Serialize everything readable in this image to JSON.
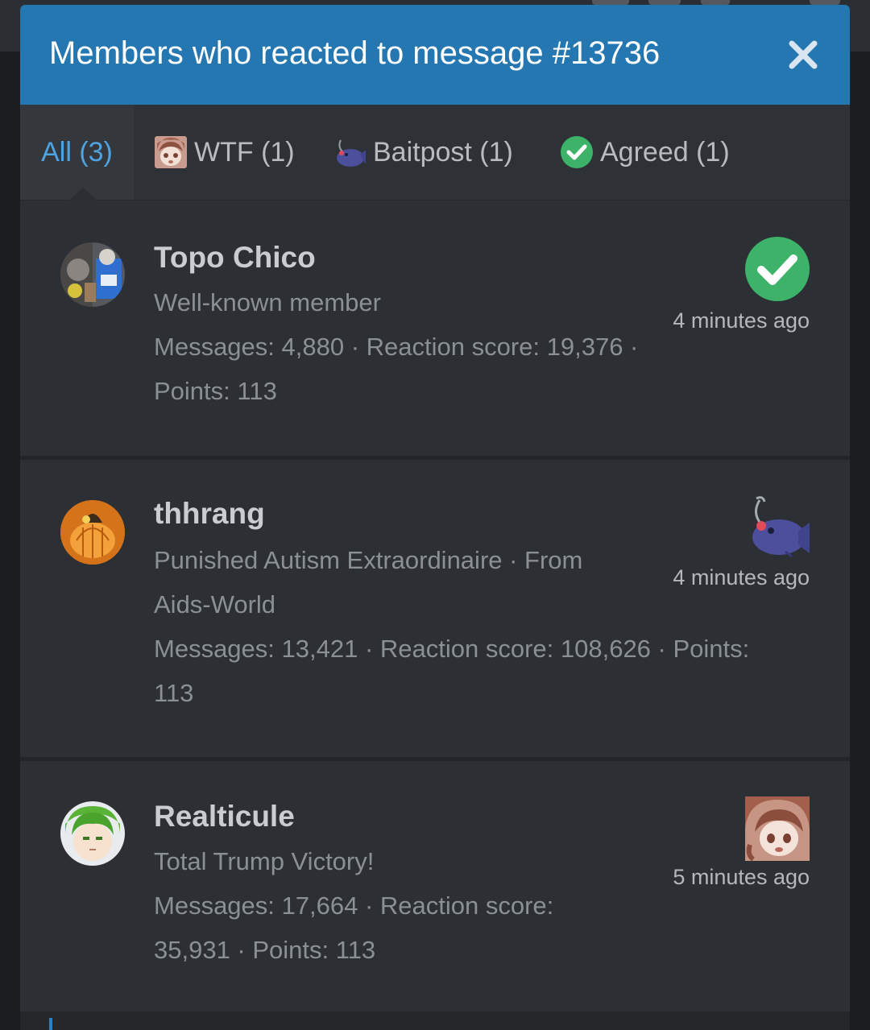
{
  "dialog": {
    "title": "Members who reacted to message #13736",
    "close_label": "×"
  },
  "tabs": [
    {
      "label": "All (3)",
      "icon": null,
      "active": true
    },
    {
      "label": "WTF (1)",
      "icon": "wtf-anime-girl-icon",
      "active": false
    },
    {
      "label": "Baitpost (1)",
      "icon": "baitpost-fish-icon",
      "active": false
    },
    {
      "label": "Agreed (1)",
      "icon": "agreed-checkmark-icon",
      "active": false
    }
  ],
  "members": [
    {
      "name": "Topo Chico",
      "title": "Well-known member",
      "meta_line1": "Messages: 4,880 · Reaction score: 19,376 ·",
      "meta_line2": "Points: 113",
      "reaction": "agreed-checkmark-icon",
      "time": "4 minutes ago"
    },
    {
      "name": "thhrang",
      "title_line1": "Punished Autism Extraordinaire · From",
      "title_line2": "Aids-World",
      "meta_line1": "Messages: 13,421 · Reaction score: 108,626 · Points:",
      "meta_line2": "113",
      "reaction": "baitpost-fish-icon",
      "time": "4 minutes ago"
    },
    {
      "name": "Realticule",
      "title": "Total Trump Victory!",
      "meta_line1": "Messages: 17,664 · Reaction score:",
      "meta_line2": "35,931 · Points: 113",
      "reaction": "wtf-anime-girl-icon",
      "time": "5 minutes ago"
    }
  ],
  "colors": {
    "header_blue": "#2577b1",
    "active_tab_text": "#4fa3e0",
    "agreed_green": "#3db36a",
    "background": "#2b2e32"
  }
}
